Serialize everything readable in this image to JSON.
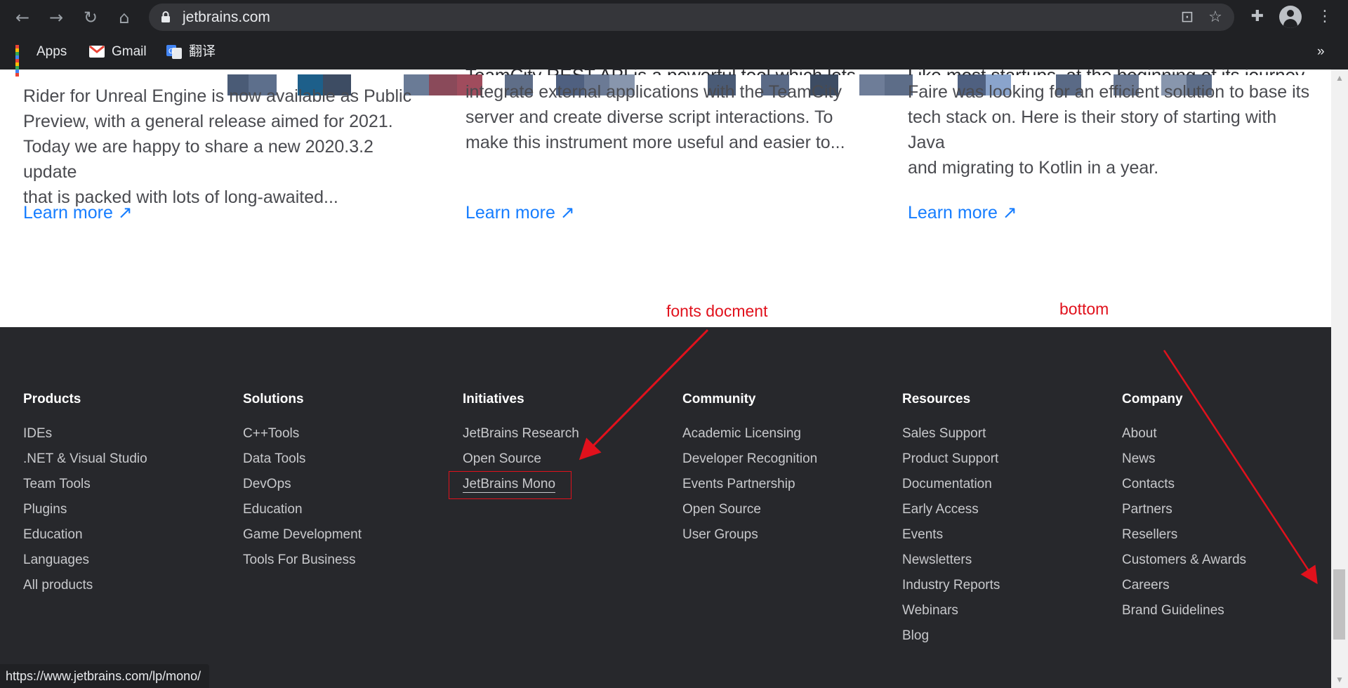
{
  "browser": {
    "url": "jetbrains.com",
    "bookmarks": [
      {
        "label": "Apps",
        "icon": "apps-grid-icon"
      },
      {
        "label": "Gmail",
        "icon": "gmail-icon"
      },
      {
        "label": "翻译",
        "icon": "google-translate-icon"
      }
    ],
    "more_bookmarks": "»"
  },
  "articles": [
    {
      "clipped_title": "",
      "lines": [
        "Rider for Unreal Engine is now available as Public",
        "Preview, with a general release aimed for 2021.",
        "Today we are happy to share a new 2020.3.2 update",
        "that is packed with lots of long-awaited..."
      ],
      "learn_more": "Learn more ↗"
    },
    {
      "clipped_title": "TeamCity REST API is a powerful tool which lets you",
      "lines": [
        "integrate external applications with the TeamCity",
        "server and create diverse script interactions. To",
        "make this instrument more useful and easier to..."
      ],
      "learn_more": "Learn more ↗"
    },
    {
      "clipped_title": "Like most startups, at the beginning of its journey",
      "lines": [
        "Faire was looking for an efficient solution to base its",
        "tech stack on. Here is their story of starting with Java",
        "and migrating to Kotlin in a year."
      ],
      "learn_more": "Learn more ↗"
    }
  ],
  "annotations": {
    "fonts_note": "fonts docment",
    "bottom_note": "bottom",
    "color": "#e1111c"
  },
  "footer": {
    "columns": [
      {
        "heading": "Products",
        "links": [
          "IDEs",
          ".NET & Visual Studio",
          "Team Tools",
          "Plugins",
          "Education",
          "Languages",
          "All products"
        ]
      },
      {
        "heading": "Solutions",
        "links": [
          "C++Tools",
          "Data Tools",
          "DevOps",
          "Education",
          "Game Development",
          "Tools For Business"
        ]
      },
      {
        "heading": "Initiatives",
        "links": [
          "JetBrains Research",
          "Open Source",
          "JetBrains Mono"
        ]
      },
      {
        "heading": "Community",
        "links": [
          "Academic Licensing",
          "Developer Recognition",
          "Events Partnership",
          "Open Source",
          "User Groups"
        ]
      },
      {
        "heading": "Resources",
        "links": [
          "Sales Support",
          "Product Support",
          "Documentation",
          "Early Access",
          "Events",
          "Newsletters",
          "Industry Reports",
          "Webinars",
          "Blog"
        ]
      },
      {
        "heading": "Company",
        "links": [
          "About",
          "News",
          "Contacts",
          "Partners",
          "Resellers",
          "Customers & Awards",
          "Careers",
          "Brand Guidelines"
        ]
      }
    ]
  },
  "status_bar": "https://www.jetbrains.com/lp/mono/",
  "colors": {
    "link_blue": "#167dff",
    "footer_bg": "#27282c",
    "chrome_bg": "#202124"
  }
}
